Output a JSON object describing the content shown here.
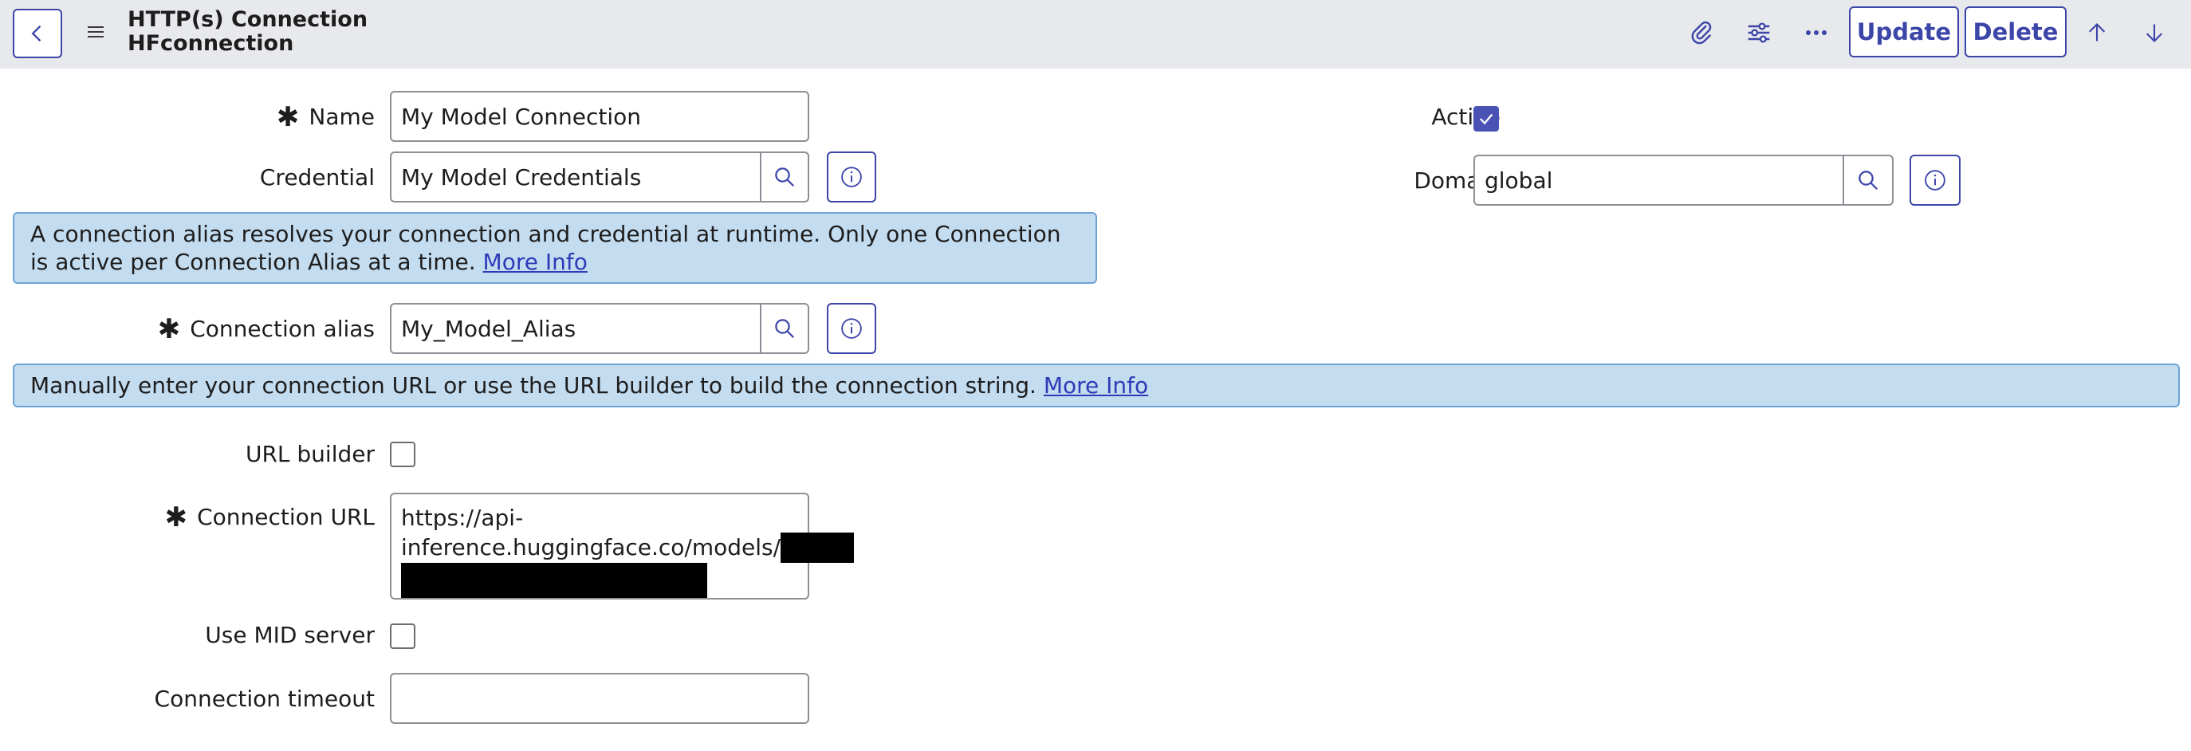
{
  "header": {
    "title": "HTTP(s) Connection",
    "subtitle": "HFconnection",
    "update_label": "Update",
    "delete_label": "Delete"
  },
  "form": {
    "name": {
      "label": "Name",
      "value": "My Model Connection"
    },
    "active": {
      "label": "Active",
      "checked": true
    },
    "credential": {
      "label": "Credential",
      "value": "My Model Credentials"
    },
    "domain": {
      "label": "Domain",
      "value": "global"
    },
    "alias_banner": {
      "text": "A connection alias resolves your connection and credential at runtime. Only one Connection is active per Connection Alias at a time.",
      "link": "More Info"
    },
    "connection_alias": {
      "label": "Connection alias",
      "value": "My_Model_Alias"
    },
    "url_banner": {
      "text": "Manually enter your connection URL or use the URL builder to build the connection string.",
      "link": "More Info"
    },
    "url_builder": {
      "label": "URL builder",
      "checked": false
    },
    "connection_url": {
      "label": "Connection URL",
      "line1": "https://api-",
      "line2": "inference.huggingface.co/models/"
    },
    "use_mid_server": {
      "label": "Use MID server",
      "checked": false
    },
    "connection_timeout": {
      "label": "Connection timeout",
      "value": ""
    }
  },
  "colors": {
    "accent": "#3c45a8",
    "header_bg": "#e8e9ec",
    "banner_bg": "#c4dcf0",
    "checkbox_checked": "#4a52b5"
  },
  "icons": {
    "back": "chevron-left-icon",
    "menu": "hamburger-icon",
    "attach": "paperclip-icon",
    "settings": "sliders-icon",
    "more": "ellipsis-icon",
    "up": "arrow-up-icon",
    "down": "arrow-down-icon",
    "search": "search-icon",
    "info": "info-icon"
  }
}
